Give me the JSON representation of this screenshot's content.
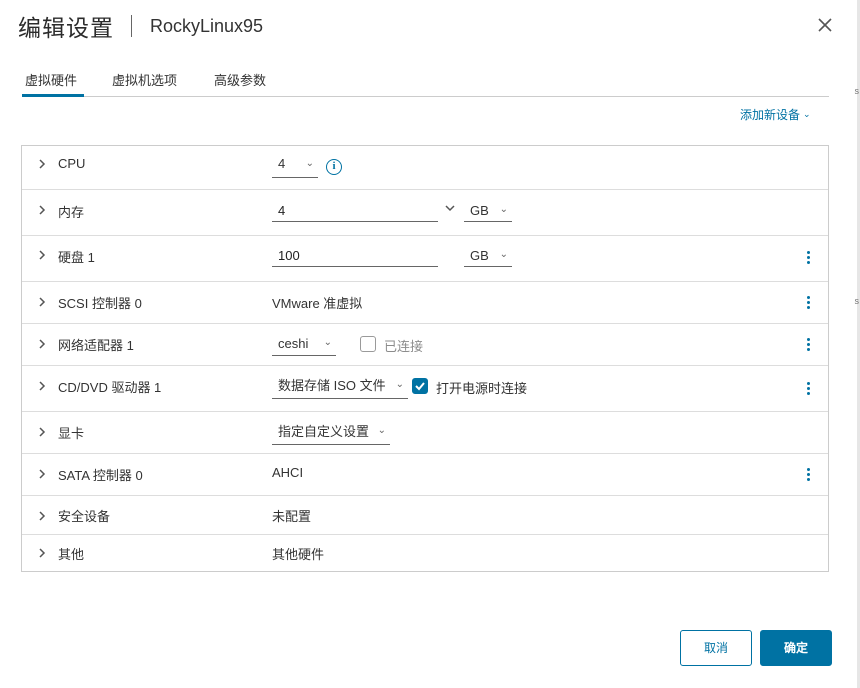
{
  "dialog": {
    "title": "编辑设置",
    "vm_name": "RockyLinux95"
  },
  "tabs": [
    {
      "label": "虚拟硬件",
      "active": true
    },
    {
      "label": "虚拟机选项",
      "active": false
    },
    {
      "label": "高级参数",
      "active": false
    }
  ],
  "add_device": {
    "label": "添加新设备"
  },
  "hardware": {
    "cpu": {
      "label": "CPU",
      "value": "4"
    },
    "memory": {
      "label": "内存",
      "value": "4",
      "unit": "GB"
    },
    "disk": {
      "label": "硬盘 1",
      "value": "100",
      "unit": "GB"
    },
    "scsi": {
      "label": "SCSI 控制器 0",
      "value": "VMware 准虚拟"
    },
    "network": {
      "label": "网络适配器 1",
      "value": "ceshi",
      "connected_label": "已连接",
      "connected": false
    },
    "cdrom": {
      "label": "CD/DVD 驱动器 1",
      "value": "数据存储 ISO 文件",
      "power_on_label": "打开电源时连接",
      "power_on": true
    },
    "video": {
      "label": "显卡",
      "value": "指定自定义设置"
    },
    "sata": {
      "label": "SATA 控制器 0",
      "value": "AHCI"
    },
    "security": {
      "label": "安全设备",
      "value": "未配置"
    },
    "other": {
      "label": "其他",
      "value": "其他硬件"
    }
  },
  "buttons": {
    "cancel": "取消",
    "ok": "确定"
  },
  "colors": {
    "accent": "#0072a3",
    "border": "#cccccc"
  }
}
